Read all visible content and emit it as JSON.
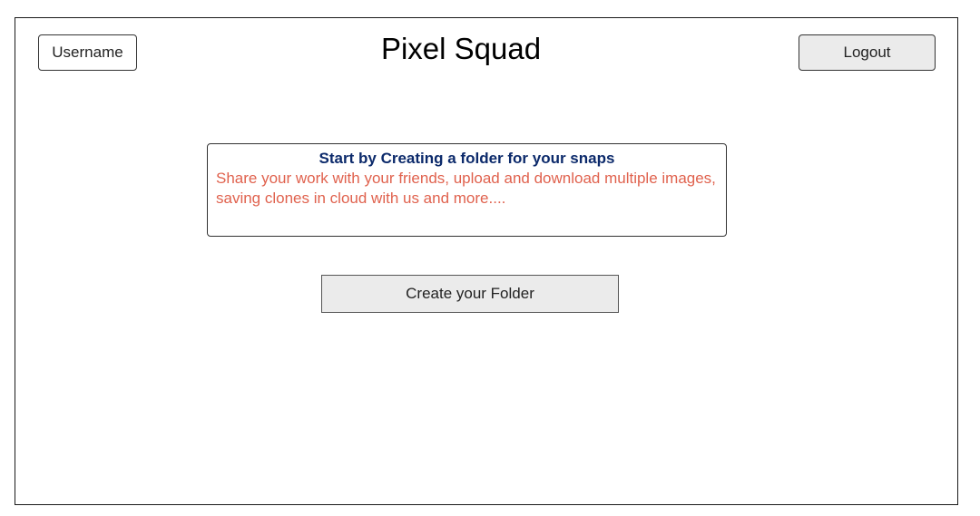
{
  "header": {
    "username_label": "Username",
    "title": "Pixel Squad",
    "logout_label": "Logout"
  },
  "info": {
    "heading": "Start by Creating a folder for your snaps",
    "body": "Share your work with your friends, upload and download multiple images, saving clones in cloud with us and more...."
  },
  "actions": {
    "create_folder_label": "Create your Folder"
  },
  "colors": {
    "heading_text": "#0c2a6b",
    "body_text": "#e0624e",
    "button_fill": "#ebebeb"
  }
}
